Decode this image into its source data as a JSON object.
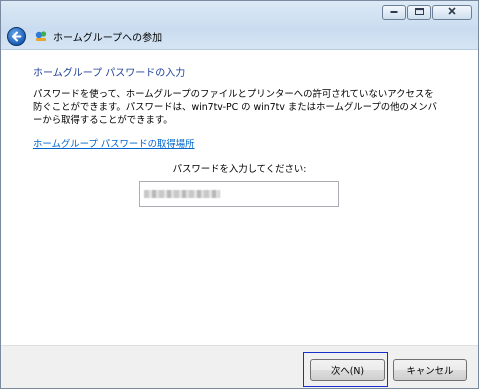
{
  "window": {
    "title": "ホームグループへの参加",
    "caption_buttons": {
      "minimize": "▭",
      "maximize": "▢",
      "close": "✕"
    }
  },
  "content": {
    "heading": "ホームグループ パスワードの入力",
    "description_line1": "パスワードを使って、ホームグループのファイルとプリンターへの許可されていないアクセスを",
    "description_line2": "防ぐことができます。パスワードは、win7tv-PC の win7tv またはホームグループの他のメンバ",
    "description_line3": "ーから取得することができます。",
    "help_link": "ホームグループ パスワードの取得場所",
    "prompt": "パスワードを入力してください:",
    "password_value": ""
  },
  "footer": {
    "next_label": "次へ(N)",
    "cancel_label": "キャンセル"
  },
  "icons": {
    "back": "back-arrow-icon",
    "app": "homegroup-icon"
  },
  "colors": {
    "heading": "#1e3f9c",
    "link": "#0066cc",
    "focus": "#1a2ecc"
  }
}
